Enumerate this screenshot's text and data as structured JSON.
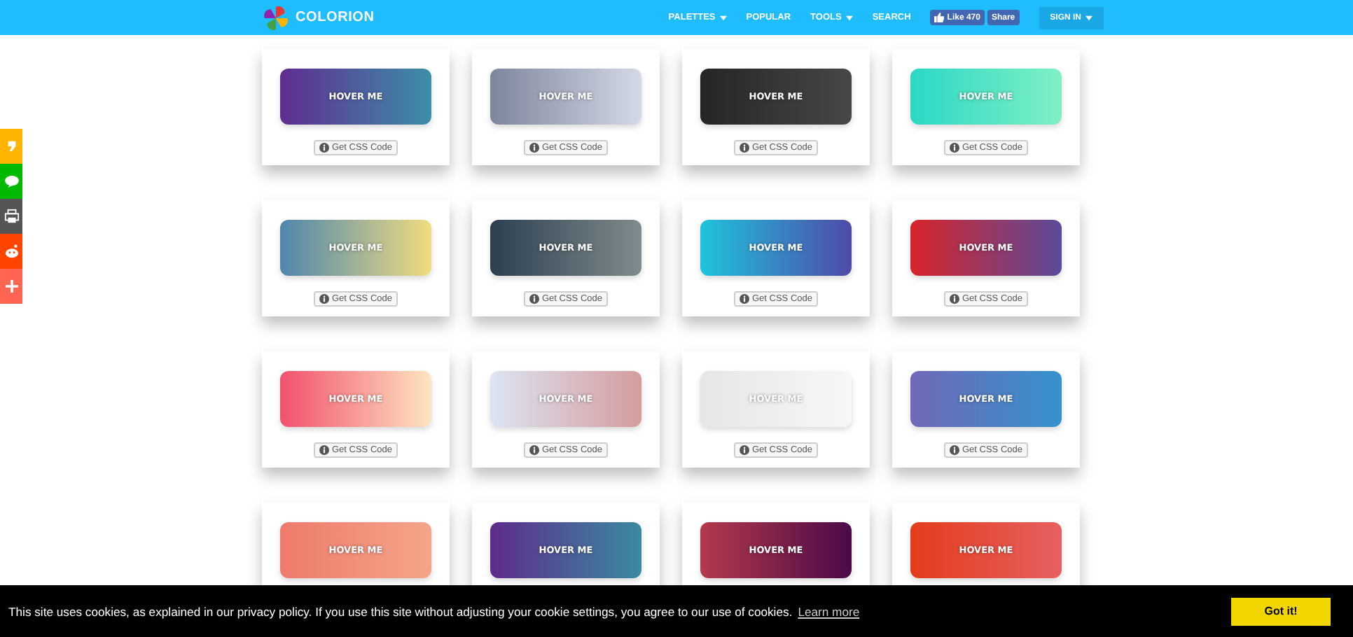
{
  "header": {
    "brand": "COLORION",
    "nav": [
      {
        "label": "PALETTES",
        "has_menu": true
      },
      {
        "label": "POPULAR",
        "has_menu": false
      },
      {
        "label": "TOOLS",
        "has_menu": true
      },
      {
        "label": "SEARCH",
        "has_menu": false
      }
    ],
    "like_label": "Like 470",
    "share_label": "Share",
    "sign_in": {
      "label": "SIGN IN",
      "has_menu": true
    }
  },
  "share_bar": [
    {
      "kind": "quote",
      "color": "#ffb400"
    },
    {
      "kind": "chat",
      "color": "#00b900"
    },
    {
      "kind": "print",
      "color": "#555555"
    },
    {
      "kind": "reddit",
      "color": "#ff4500"
    },
    {
      "kind": "plus",
      "color": "#ff6550"
    }
  ],
  "cards": [
    {
      "label": "HOVER ME",
      "stops": [
        {
          "color": "#5f2c91"
        },
        {
          "color": "#3d8ea8"
        }
      ],
      "code_label": "Get CSS Code"
    },
    {
      "label": "HOVER ME",
      "stops": [
        {
          "color": "#7e869d"
        },
        {
          "color": "#d3d9e6"
        }
      ],
      "code_label": "Get CSS Code"
    },
    {
      "label": "HOVER ME",
      "stops": [
        {
          "color": "#232526"
        },
        {
          "color": "#454748"
        }
      ],
      "code_label": "Get CSS Code"
    },
    {
      "label": "HOVER ME",
      "stops": [
        {
          "color": "#2bd8c5"
        },
        {
          "color": "#80f0c4"
        }
      ],
      "code_label": "Get CSS Code"
    },
    {
      "label": "HOVER ME",
      "stops": [
        {
          "color": "#4e86ad"
        },
        {
          "color": "#f1dc80"
        }
      ],
      "code_label": "Get CSS Code"
    },
    {
      "label": "HOVER ME",
      "stops": [
        {
          "color": "#2c3e50"
        },
        {
          "color": "#7f8c8d"
        }
      ],
      "code_label": "Get CSS Code"
    },
    {
      "label": "HOVER ME",
      "stops": [
        {
          "color": "#1fc3dd"
        },
        {
          "color": "#4f4aa8"
        }
      ],
      "code_label": "Get CSS Code"
    },
    {
      "label": "HOVER ME",
      "stops": [
        {
          "color": "#d8232a"
        },
        {
          "color": "#5a4b9a"
        }
      ],
      "code_label": "Get CSS Code"
    },
    {
      "label": "HOVER ME",
      "stops": [
        {
          "color": "#f2506e"
        },
        {
          "color": "#fde5c0"
        }
      ],
      "code_label": "Get CSS Code"
    },
    {
      "label": "HOVER ME",
      "stops": [
        {
          "color": "#dce4f4"
        },
        {
          "color": "#d59c9c"
        }
      ],
      "code_label": "Get CSS Code"
    },
    {
      "label": "HOVER ME",
      "stops": [
        {
          "color": "#e8e6e4"
        },
        {
          "color": "#f8f7f6"
        }
      ],
      "code_label": "Get CSS Code"
    },
    {
      "label": "HOVER ME",
      "stops": [
        {
          "color": "#7068b8"
        },
        {
          "color": "#3692cc"
        }
      ],
      "code_label": "Get CSS Code"
    },
    {
      "label": "HOVER ME",
      "stops": [
        {
          "color": "#ef7a6c"
        },
        {
          "color": "#f3a58a"
        }
      ]
    },
    {
      "label": "HOVER ME",
      "stops": [
        {
          "color": "#5e2b8c"
        },
        {
          "color": "#3a8aa0"
        }
      ]
    },
    {
      "label": "HOVER ME",
      "stops": [
        {
          "color": "#b4394c"
        },
        {
          "color": "#4a0a48"
        }
      ]
    },
    {
      "label": "HOVER ME",
      "stops": [
        {
          "color": "#e43c1c"
        },
        {
          "color": "#e66060"
        }
      ]
    }
  ],
  "cookie_bar": {
    "message": "This site uses cookies, as explained in our privacy policy. If you use this site without adjusting your cookie settings, you agree to our use of cookies.",
    "link": "Learn more",
    "button": "Got it!"
  }
}
